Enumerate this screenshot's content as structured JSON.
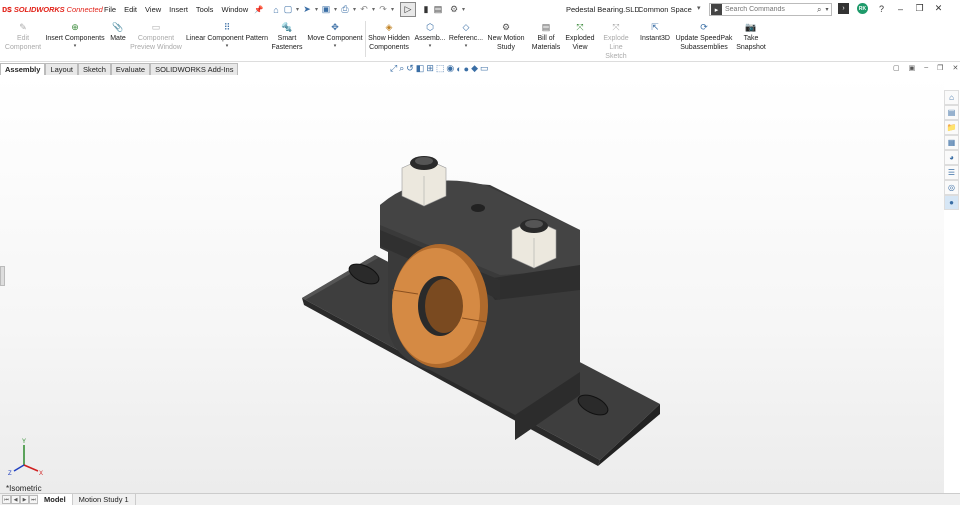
{
  "app": {
    "brand": "SOLIDWORKS",
    "brand_suffix": "Connected",
    "document_title": "Pedestal Bearing.SLD",
    "space": "Common Space"
  },
  "menu": [
    "File",
    "Edit",
    "View",
    "Insert",
    "Tools",
    "Window"
  ],
  "search": {
    "placeholder": "Search Commands"
  },
  "user": {
    "initials": "RK"
  },
  "commands": [
    {
      "label": "Edit\nComponent",
      "icon": "edit-component-icon",
      "enabled": false
    },
    {
      "label": "Insert Components",
      "icon": "insert-components-icon",
      "enabled": true
    },
    {
      "label": "Mate",
      "icon": "mate-icon",
      "enabled": true
    },
    {
      "label": "Component\nPreview Window",
      "icon": "preview-window-icon",
      "enabled": false
    },
    {
      "label": "Linear Component Pattern",
      "icon": "linear-pattern-icon",
      "enabled": true
    },
    {
      "label": "Smart\nFasteners",
      "icon": "smart-fasteners-icon",
      "enabled": true
    },
    {
      "label": "Move Component",
      "icon": "move-component-icon",
      "enabled": true
    },
    {
      "label": "Show Hidden\nComponents",
      "icon": "show-hidden-icon",
      "enabled": true
    },
    {
      "label": "Assemb...",
      "icon": "assembly-features-icon",
      "enabled": true
    },
    {
      "label": "Referenc...",
      "icon": "reference-geometry-icon",
      "enabled": true
    },
    {
      "label": "New Motion\nStudy",
      "icon": "motion-study-icon",
      "enabled": true
    },
    {
      "label": "Bill of\nMaterials",
      "icon": "bom-icon",
      "enabled": true
    },
    {
      "label": "Exploded\nView",
      "icon": "exploded-view-icon",
      "enabled": true
    },
    {
      "label": "Explode\nLine Sketch",
      "icon": "explode-line-icon",
      "enabled": false
    },
    {
      "label": "Instant3D",
      "icon": "instant3d-icon",
      "enabled": true
    },
    {
      "label": "Update SpeedPak\nSubassemblies",
      "icon": "speedpak-icon",
      "enabled": true
    },
    {
      "label": "Take\nSnapshot",
      "icon": "snapshot-icon",
      "enabled": true
    }
  ],
  "tabs": [
    "Assembly",
    "Layout",
    "Sketch",
    "Evaluate",
    "SOLIDWORKS Add-Ins"
  ],
  "active_tab": "Assembly",
  "viewport": {
    "view_name": "*Isometric"
  },
  "bottom_tabs": [
    "Model",
    "Motion Study 1"
  ],
  "active_bottom_tab": "Model",
  "colors": {
    "brand_red": "#e2231a",
    "body_dark": "#3a3a3a",
    "bushing": "#c87a3a",
    "nut": "#e8e4da",
    "accent_blue": "#3a6ea5"
  }
}
